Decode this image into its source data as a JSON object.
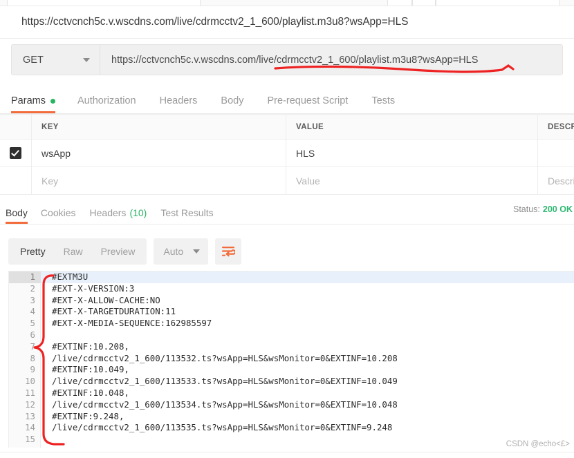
{
  "request": {
    "url_title": "https://cctvcnch5c.v.wscdns.com/live/cdrmcctv2_1_600/playlist.m3u8?wsApp=HLS",
    "method": "GET",
    "url_value": "https://cctvcnch5c.v.wscdns.com/live/cdrmcctv2_1_600/playlist.m3u8?wsApp=HLS",
    "tabs": [
      {
        "label": "Params",
        "active": true,
        "dot": true
      },
      {
        "label": "Authorization",
        "active": false,
        "dot": false
      },
      {
        "label": "Headers",
        "active": false,
        "dot": false
      },
      {
        "label": "Body",
        "active": false,
        "dot": false
      },
      {
        "label": "Pre-request Script",
        "active": false,
        "dot": false
      },
      {
        "label": "Tests",
        "active": false,
        "dot": false
      }
    ]
  },
  "params": {
    "headers": {
      "key": "KEY",
      "value": "VALUE",
      "description": "DESCRIP"
    },
    "rows": [
      {
        "checked": true,
        "key": "wsApp",
        "value": "HLS",
        "description": ""
      }
    ],
    "placeholders": {
      "key": "Key",
      "value": "Value",
      "description": "Descri"
    }
  },
  "response": {
    "tabs": [
      {
        "label": "Body",
        "active": true,
        "count": ""
      },
      {
        "label": "Cookies",
        "active": false,
        "count": ""
      },
      {
        "label": "Headers",
        "active": false,
        "count": "(10)"
      },
      {
        "label": "Test Results",
        "active": false,
        "count": ""
      }
    ],
    "status_label": "Status:",
    "status_value": "200 OK",
    "toolbar": {
      "pretty": "Pretty",
      "raw": "Raw",
      "preview": "Preview",
      "format": "Auto"
    },
    "body_lines": [
      "#EXTM3U",
      "#EXT-X-VERSION:3",
      "#EXT-X-ALLOW-CACHE:NO",
      "#EXT-X-TARGETDURATION:11",
      "#EXT-X-MEDIA-SEQUENCE:162985597",
      "",
      "#EXTINF:10.208,",
      "/live/cdrmcctv2_1_600/113532.ts?wsApp=HLS&wsMonitor=0&EXTINF=10.208",
      "#EXTINF:10.049,",
      "/live/cdrmcctv2_1_600/113533.ts?wsApp=HLS&wsMonitor=0&EXTINF=10.049",
      "#EXTINF:10.048,",
      "/live/cdrmcctv2_1_600/113534.ts?wsApp=HLS&wsMonitor=0&EXTINF=10.048",
      "#EXTINF:9.248,",
      "/live/cdrmcctv2_1_600/113535.ts?wsApp=HLS&wsMonitor=0&EXTINF=9.248",
      ""
    ]
  },
  "annotations": {
    "accent_color": "#f26b3a",
    "mark_color": "#ee2222",
    "success_color": "#2eb872"
  },
  "watermark": {
    "text": "CSDN @echo<£>"
  }
}
